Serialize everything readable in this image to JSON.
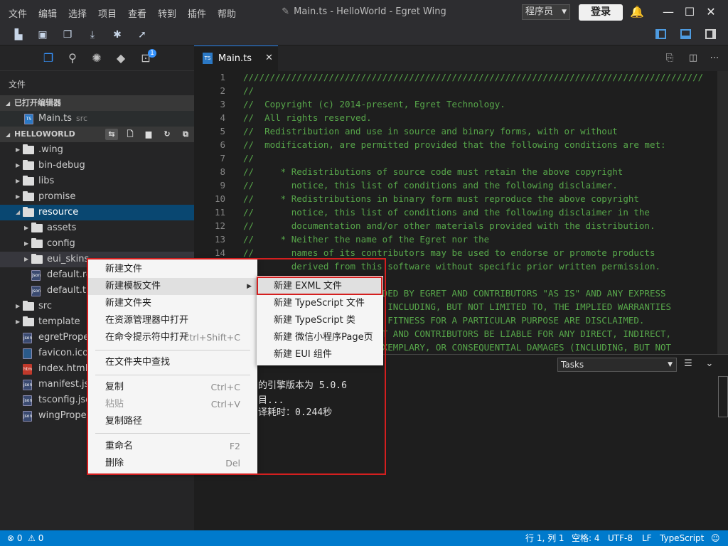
{
  "titlebar": {
    "menus": [
      "文件",
      "编辑",
      "选择",
      "项目",
      "查看",
      "转到",
      "插件",
      "帮助"
    ],
    "title": "Main.ts - HelloWorld - Egret Wing",
    "user_select": "程序员",
    "login_label": "登录",
    "window_buttons": [
      "minimize-icon",
      "maximize-icon",
      "close-icon"
    ]
  },
  "toolbar": {
    "icons": [
      "new-project-icon",
      "save-icon",
      "save-all-icon",
      "build-icon",
      "debug-icon",
      "publish-icon"
    ],
    "layout_icons": [
      "sidebar-layout-icon",
      "panel-layout-icon",
      "split-layout-icon"
    ]
  },
  "sidebar": {
    "activity": [
      "explorer-icon",
      "search-icon",
      "extensions-icon",
      "git-icon",
      "problems-icon"
    ],
    "badge": "1",
    "title": "文件",
    "open_editors_header": "已打开编辑器",
    "open_editors": [
      {
        "name": "Main.ts",
        "hint": "src"
      }
    ],
    "project_header": "HELLOWORLD",
    "tree": [
      {
        "name": ".wing",
        "type": "folder",
        "depth": 0,
        "expanded": false
      },
      {
        "name": "bin-debug",
        "type": "folder",
        "depth": 0,
        "expanded": false
      },
      {
        "name": "libs",
        "type": "folder",
        "depth": 0,
        "expanded": false
      },
      {
        "name": "promise",
        "type": "folder",
        "depth": 0,
        "expanded": false
      },
      {
        "name": "resource",
        "type": "folder",
        "depth": 0,
        "expanded": true
      },
      {
        "name": "assets",
        "type": "folder",
        "depth": 1,
        "expanded": false
      },
      {
        "name": "config",
        "type": "folder",
        "depth": 1,
        "expanded": false
      },
      {
        "name": "eui_skins",
        "type": "folder",
        "depth": 1,
        "expanded": false
      },
      {
        "name": "default.res",
        "type": "json",
        "depth": 1
      },
      {
        "name": "default.thm",
        "type": "json",
        "depth": 1
      },
      {
        "name": "src",
        "type": "folder",
        "depth": 0,
        "expanded": false
      },
      {
        "name": "template",
        "type": "folder",
        "depth": 0,
        "expanded": false
      },
      {
        "name": "egretProper",
        "type": "json",
        "depth": 0
      },
      {
        "name": "favicon.ico",
        "type": "ico",
        "depth": 0
      },
      {
        "name": "index.html",
        "type": "html",
        "depth": 0
      },
      {
        "name": "manifest.jso",
        "type": "json",
        "depth": 0
      },
      {
        "name": "tsconfig.json",
        "type": "json",
        "depth": 0
      },
      {
        "name": "wingPropert",
        "type": "json",
        "depth": 0
      }
    ]
  },
  "editor": {
    "tab_label": "Main.ts",
    "tab_icon": "TS",
    "lines": [
      "//////////////////////////////////////////////////////////////////////////////////////",
      "//",
      "//  Copyright (c) 2014-present, Egret Technology.",
      "//  All rights reserved.",
      "//  Redistribution and use in source and binary forms, with or without",
      "//  modification, are permitted provided that the following conditions are met:",
      "//",
      "//     * Redistributions of source code must retain the above copyright",
      "//       notice, this list of conditions and the following disclaimer.",
      "//     * Redistributions in binary form must reproduce the above copyright",
      "//       notice, this list of conditions and the following disclaimer in the",
      "//       documentation and/or other materials provided with the distribution.",
      "//     * Neither the name of the Egret nor the",
      "//       names of its contributors may be used to endorse or promote products",
      "//       derived from this software without specific prior written permission.",
      "//",
      "//  THIS SOFTWARE IS PROVIDED BY EGRET AND CONTRIBUTORS \"AS IS\" AND ANY EXPRESS",
      "//  OR IMPLIED WARRANTIES, INCLUDING, BUT NOT LIMITED TO, THE IMPLIED WARRANTIES",
      "//  OF MERCHANTABILITY AND FITNESS FOR A PARTICULAR PURPOSE ARE DISCLAIMED.",
      "//  IN NO EVENT SHALL EGRET AND CONTRIBUTORS BE LIABLE FOR ANY DIRECT, INDIRECT,",
      "//  INCIDENTAL, SPECIAL, EXEMPLARY, OR CONSEQUENTIAL DAMAGES (INCLUDING, BUT NOT"
    ]
  },
  "panel": {
    "tasks_select": "Tasks",
    "output": [
      "的引擎版本为 5.0.6",
      "目...",
      "译耗时：0.244秒"
    ]
  },
  "status": {
    "errors": "0",
    "warnings": "0",
    "position": "行 1, 列 1",
    "spaces": "空格: 4",
    "encoding": "UTF-8",
    "eol": "LF",
    "language": "TypeScript"
  },
  "context_menu": {
    "items": [
      {
        "label": "新建文件",
        "shortcut": ""
      },
      {
        "label": "新建模板文件",
        "shortcut": "",
        "submenu": true
      },
      {
        "label": "新建文件夹",
        "shortcut": ""
      },
      {
        "label": "在资源管理器中打开",
        "shortcut": ""
      },
      {
        "label": "在命令提示符中打开",
        "shortcut": "Ctrl+Shift+C"
      },
      {
        "label": "在文件夹中查找",
        "shortcut": ""
      },
      {
        "label": "复制",
        "shortcut": "Ctrl+C"
      },
      {
        "label": "粘贴",
        "shortcut": "Ctrl+V",
        "disabled": true
      },
      {
        "label": "复制路径",
        "shortcut": ""
      },
      {
        "label": "重命名",
        "shortcut": "F2"
      },
      {
        "label": "删除",
        "shortcut": "Del"
      }
    ]
  },
  "submenu": {
    "items": [
      "新建 EXML 文件",
      "新建 TypeScript 文件",
      "新建 TypeScript 类",
      "新建 微信小程序Page页",
      "新建 EUI 组件"
    ]
  },
  "colors": {
    "accent": "#007acc",
    "highlight": "#d41f1f",
    "comment": "#57a64a",
    "selection": "#094771"
  }
}
